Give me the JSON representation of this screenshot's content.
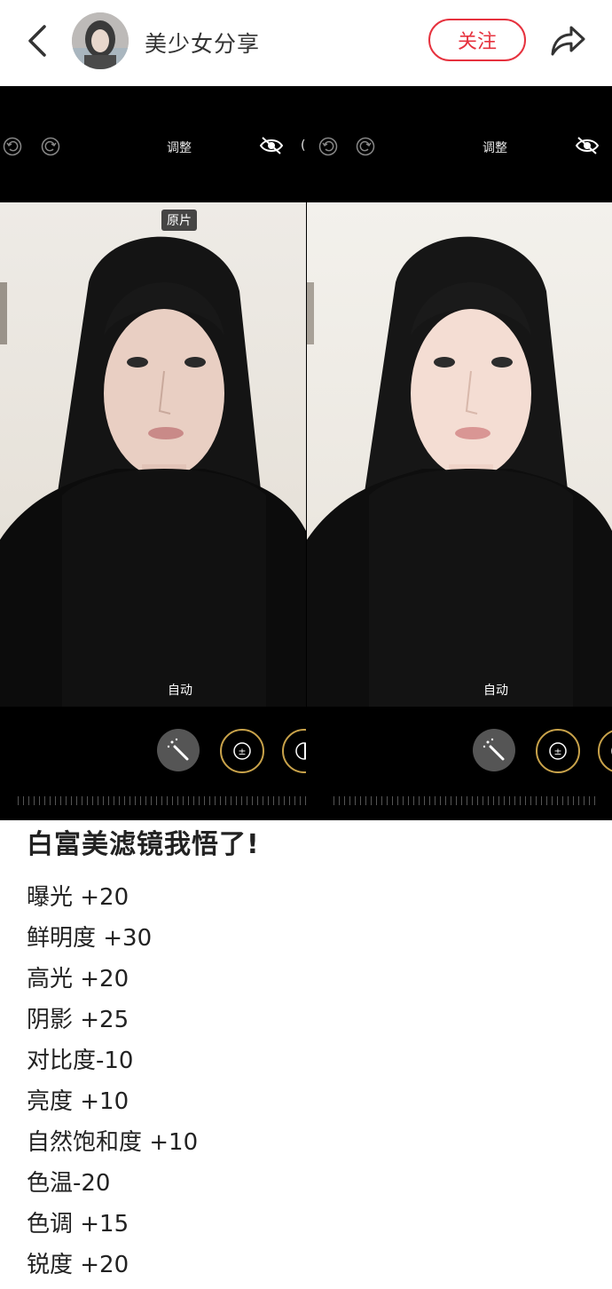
{
  "header": {
    "author_name": "美少女分享",
    "follow_label": "关注"
  },
  "photos": {
    "panels": [
      {
        "toolbar_title": "调整",
        "tag_top": "原片",
        "tag_bottom": "自动",
        "partial_bracket": "("
      },
      {
        "toolbar_title": "调整",
        "tag_bottom": "自动"
      }
    ]
  },
  "post": {
    "title": "白富美滤镜我悟了!",
    "settings": [
      "曝光 +20",
      "鲜明度 +30",
      "高光 +20",
      "阴影 +25",
      "对比度-10",
      "亮度 +10",
      "自然饱和度 +10",
      "色温-20",
      "色调 +15",
      "锐度 +20"
    ]
  },
  "colors": {
    "accent": "#e6323e",
    "background": "#ffffff",
    "editor_background": "#000000",
    "dial_ring": "#c8a24a"
  },
  "icons": [
    "back-chevron-icon",
    "share-arrow-icon",
    "undo-icon",
    "redo-icon",
    "hide-eye-icon",
    "magic-wand-icon",
    "exposure-icon",
    "brilliance-icon"
  ]
}
